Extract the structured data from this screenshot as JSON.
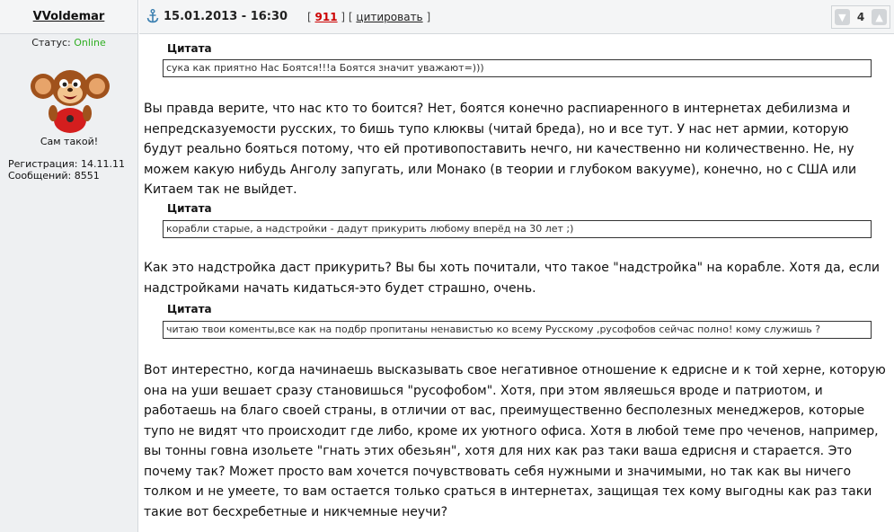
{
  "user": {
    "name": "VVoldemar",
    "status_label": "Статус: ",
    "status_value": "Online",
    "title": "Сам такой!",
    "reg_line": "Регистрация: 14.11.11",
    "posts_line": "Сообщений: 8551"
  },
  "post": {
    "datetime": "15.01.2013 - 16:30",
    "bracket_open": "[",
    "number": "911",
    "bracket_mid": "] [",
    "quote_link": "цитировать",
    "bracket_close": "]",
    "rating_count": "4",
    "quote_label": "Цитата",
    "quotes": [
      "сука как приятно Нас Боятся!!!а Боятся значит уважают=)))",
      "корабли старые, а надстройки - дадут прикурить любому вперёд на 30 лет ;)",
      "читаю твои коменты,все как на подбр пропитаны ненавистью ко всему Русскому ,русофобов сейчас полно! кому служишь ?"
    ],
    "paragraphs": [
      "Вы правда верите, что нас кто то боится? Нет, боятся конечно распиаренного в интернетах дебилизма и непредсказуемости русских, то бишь тупо клюквы (читай бреда), но и все тут. У нас нет армии, которую будут реально бояться потому, что ей противопоставить нечго, ни качественно ни количественно. Не, ну можем какую нибудь Анголу запугать, или Монако (в теории и глубоком вакууме), конечно, но с США или Китаем так не выйдет.",
      "Как это надстройка даст прикурить? Вы бы хоть почитали, что такое \"надстройка\" на корабле. Хотя да, если надстройками начать кидаться-это будет страшно, очень.",
      "Вот интерестно, когда начинаешь высказывать свое негативное отношение к едрисне и к той херне, которую она на уши вешает сразу становишься \"русофобом\". Хотя, при этом являешься вроде и патриотом, и работаешь на благо своей страны, в отличии от вас, преимущественно бесполезных менеджеров, которые тупо не видят что происходит где либо, кроме их уютного офиса. Хотя в любой теме про чеченов, например, вы тонны говна изольете \"гнать этих обезьян\", хотя для них как раз таки ваша едрисня и старается. Это почему так? Может просто вам хочется почувствовать себя нужными и значимыми, но так как вы ничего толком и не умеете, то вам остается только сраться в интернетах, защищая тех кому выгодны как раз таки такие вот бесхребетные и никчемные неучи?"
    ]
  },
  "colors": {
    "online": "#2fae22",
    "post_number": "#cc0000",
    "sidebar_bg": "#eef0f2"
  }
}
